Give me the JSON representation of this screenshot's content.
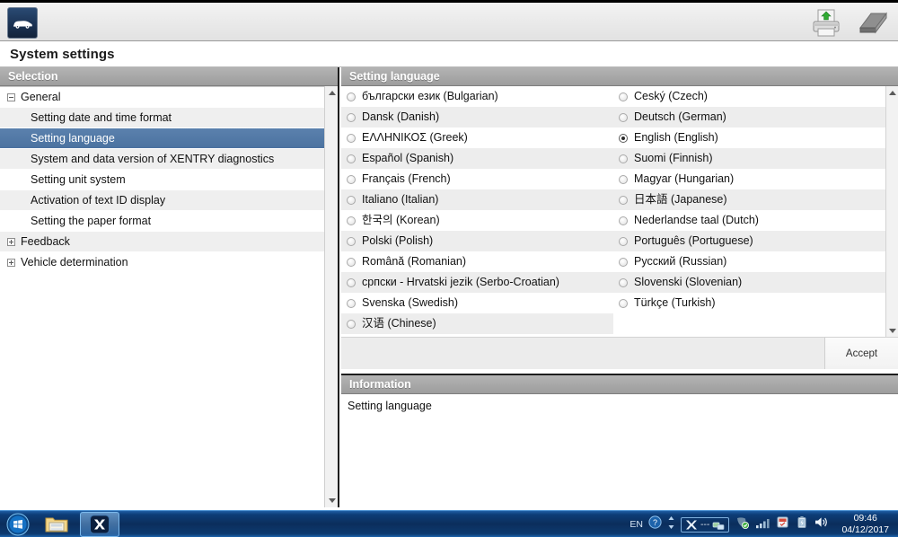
{
  "window": {
    "logo_icon": "car-icon",
    "title": "System settings",
    "print_icon": "printer-upload-icon",
    "book_icon": "notepad-icon"
  },
  "selection_panel": {
    "header": "Selection",
    "items": [
      {
        "label": "General",
        "level": "root",
        "expander": "minus",
        "selected": false
      },
      {
        "label": "Setting date and time format",
        "level": "child",
        "expander": "none",
        "selected": false
      },
      {
        "label": "Setting language",
        "level": "child",
        "expander": "none",
        "selected": true
      },
      {
        "label": "System and data version of XENTRY diagnostics",
        "level": "child",
        "expander": "none",
        "selected": false
      },
      {
        "label": "Setting unit system",
        "level": "child",
        "expander": "none",
        "selected": false
      },
      {
        "label": "Activation of text ID display",
        "level": "child",
        "expander": "none",
        "selected": false
      },
      {
        "label": "Setting the paper format",
        "level": "child",
        "expander": "none",
        "selected": false
      },
      {
        "label": "Feedback",
        "level": "root",
        "expander": "plus",
        "selected": false
      },
      {
        "label": "Vehicle determination",
        "level": "root",
        "expander": "plus",
        "selected": false
      }
    ],
    "scroll_up_icon": "scroll-up-arrow-icon",
    "scroll_down_icon": "scroll-down-arrow-icon"
  },
  "language_panel": {
    "header": "Setting language",
    "left_column": [
      {
        "label": "български език (Bulgarian)",
        "selected": false
      },
      {
        "label": "Dansk (Danish)",
        "selected": false
      },
      {
        "label": "ΕΛΛΗΝΙΚΟΣ (Greek)",
        "selected": false
      },
      {
        "label": "Español (Spanish)",
        "selected": false
      },
      {
        "label": "Français (French)",
        "selected": false
      },
      {
        "label": "Italiano (Italian)",
        "selected": false
      },
      {
        "label": "한국의 (Korean)",
        "selected": false
      },
      {
        "label": "Polski (Polish)",
        "selected": false
      },
      {
        "label": "Română (Romanian)",
        "selected": false
      },
      {
        "label": "српски - Hrvatski jezik (Serbo-Croatian)",
        "selected": false
      },
      {
        "label": "Svenska (Swedish)",
        "selected": false
      },
      {
        "label": "汉语 (Chinese)",
        "selected": false
      }
    ],
    "right_column": [
      {
        "label": "Ceský (Czech)",
        "selected": false
      },
      {
        "label": "Deutsch (German)",
        "selected": false
      },
      {
        "label": "English (English)",
        "selected": true
      },
      {
        "label": "Suomi (Finnish)",
        "selected": false
      },
      {
        "label": "Magyar (Hungarian)",
        "selected": false
      },
      {
        "label": "日本語 (Japanese)",
        "selected": false
      },
      {
        "label": "Nederlandse taal (Dutch)",
        "selected": false
      },
      {
        "label": "Português (Portuguese)",
        "selected": false
      },
      {
        "label": "Русский (Russian)",
        "selected": false
      },
      {
        "label": "Slovenski (Slovenian)",
        "selected": false
      },
      {
        "label": "Türkçe (Turkish)",
        "selected": false
      }
    ],
    "accept_label": "Accept",
    "scroll_up_icon": "scroll-up-arrow-icon",
    "scroll_down_icon": "scroll-down-arrow-icon"
  },
  "information_panel": {
    "header": "Information",
    "text": "Setting language"
  },
  "taskbar": {
    "start_icon": "windows-start-orb-icon",
    "items": [
      {
        "icon": "folder-explorer-icon",
        "active": false
      },
      {
        "icon": "xentry-app-icon",
        "active": true
      }
    ],
    "tray": {
      "language_indicator": "EN",
      "help_icon": "help-question-icon",
      "updown_icon": "spinner-arrows-icon",
      "xentry_tray_icon": "xentry-tray-icon",
      "dashes_label": "---",
      "connection_icon": "network-connection-icon",
      "shield_icon": "security-shield-icon",
      "signal_icon": "wifi-signal-icon",
      "flag_icon": "action-center-flag-icon",
      "battery_icon": "battery-icon",
      "volume_icon": "volume-speaker-icon",
      "time": "09:46",
      "date": "04/12/2017"
    }
  },
  "colors": {
    "selection_blue": "#4b72a0",
    "panel_header_grey": "#a8a8a8",
    "taskbar_blue": "#0b2e5c",
    "row_alt": "#ededed"
  }
}
